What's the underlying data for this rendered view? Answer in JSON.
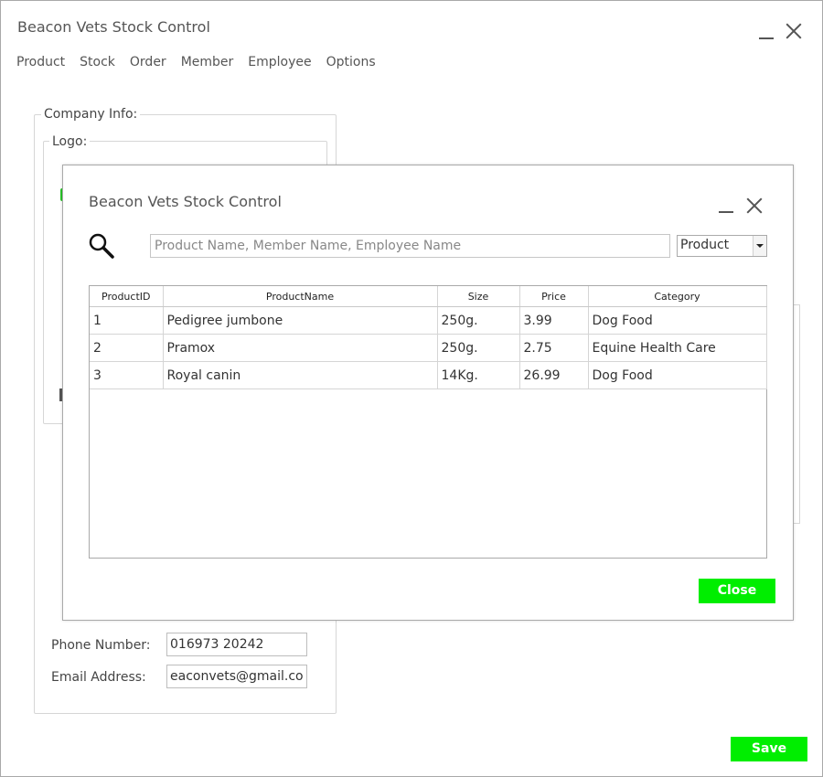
{
  "app": {
    "title": "Beacon Vets Stock Control"
  },
  "menu": {
    "items": [
      "Product",
      "Stock",
      "Order",
      "Member",
      "Employee",
      "Options"
    ]
  },
  "company": {
    "legend": "Company Info:",
    "logo_legend": "Logo:",
    "phone_label": "Phone Number:",
    "phone_value": "016973 20242",
    "email_label": "Email Address:",
    "email_value": "eaconvets@gmail.com"
  },
  "save_label": "Save",
  "dialog": {
    "title": "Beacon Vets Stock Control",
    "search_placeholder": "Product Name, Member Name, Employee Name",
    "filter_value": "Product",
    "columns": [
      "ProductID",
      "ProductName",
      "Size",
      "Price",
      "Category"
    ],
    "rows": [
      [
        "1",
        "Pedigree jumbone",
        "250g.",
        "3.99",
        "Dog Food"
      ],
      [
        "2",
        "Pramox",
        "250g.",
        "2.75",
        "Equine Health Care"
      ],
      [
        "3",
        "Royal canin",
        "14Kg.",
        "26.99",
        "Dog Food"
      ]
    ],
    "close_label": "Close"
  },
  "colors": {
    "accent_green": "#00ee00",
    "logo_green": "#27c427"
  },
  "icons": {
    "search": "magnifier-icon",
    "minimize": "minimize-icon",
    "close": "close-icon"
  }
}
